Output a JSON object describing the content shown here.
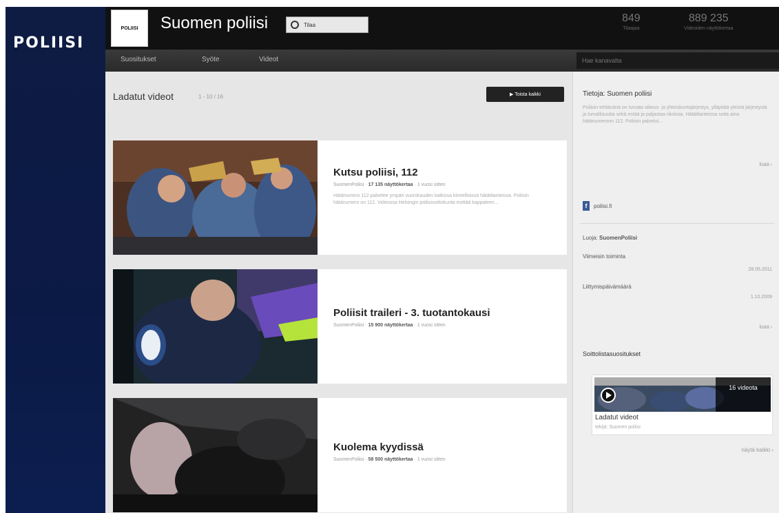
{
  "brand": {
    "logo_text": "POLIISI"
  },
  "header": {
    "avatar_text": "POLIISI",
    "channel_title": "Suomen poliisi",
    "subscribe_label": "Tilaa",
    "stats": [
      {
        "value": "849",
        "label": "Tilaajaa"
      },
      {
        "value": "889 235",
        "label": "Videoiden näyttökertaa"
      }
    ]
  },
  "nav": {
    "tabs": [
      "Suositukset",
      "Syöte",
      "Videot"
    ],
    "search_placeholder": "Hae kanavalta"
  },
  "main": {
    "heading": "Ladatut videot",
    "range": "1 - 10 / 16",
    "play_all": "▶ Toista kaikki",
    "videos": [
      {
        "title": "Kutsu poliisi, 112",
        "channel": "SuomenPoliisi",
        "views": "17 135 näyttökertaa",
        "age": "1 vuosi sitten",
        "description": "Hätänumero 112 palvelee ympäri vuorokauden kaikissa kiireellisissä hätätilanteissa. Poliisin hätänumero on 112. Videossa Helsingin poliisisoittokunta esittää kappaleen..."
      },
      {
        "title": "Poliisit traileri - 3. tuotantokausi",
        "channel": "SuomenPoliisi",
        "views": "15 900 näyttökertaa",
        "age": "1 vuosi sitten",
        "description": ""
      },
      {
        "title": "Kuolema kyydissä",
        "channel": "SuomenPoliisi",
        "views": "58 500 näyttökertaa",
        "age": "1 vuosi sitten",
        "description": ""
      }
    ]
  },
  "sidebar": {
    "about_title": "Tietoja: Suomen poliisi",
    "about_text": "Poliisin tehtävänä on turvata oikeus- ja yhteiskuntajärjestys, ylläpitää yleistä järjestystä ja turvallisuutta sekä estää ja paljastaa rikoksia. Hätätilanteissa soita aina hätänumeroon 112. Poliisin palvelut...",
    "more": "lisää ›",
    "link": "poliisi.fi",
    "user_label": "Luoja:",
    "user_value": "SuomenPoliisi",
    "rows": [
      {
        "label": "Viimeisin toiminta",
        "value": "28.05.2011"
      },
      {
        "label": "Liittymispäivämäärä",
        "value": "1.10.2009"
      }
    ],
    "playlists_title": "Soittolistasuositukset",
    "playlist": {
      "count": "16 videota",
      "title": "Ladatut videot",
      "subtitle": "tekijä: Suomen poliisi"
    },
    "show_all": "näytä kaikki ›"
  },
  "colors": {
    "brand_navy": "#0e1c44",
    "header_bg": "#111111",
    "nav_bg": "#2f2f2f",
    "content_bg": "#e6e6e6"
  }
}
